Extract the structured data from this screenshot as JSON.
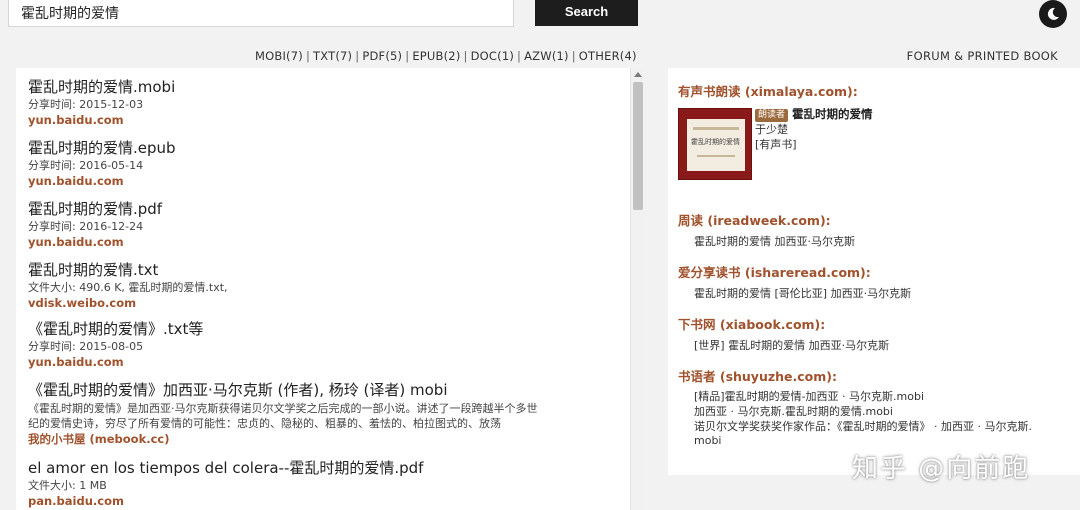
{
  "search": {
    "query": "霍乱时期的爱情",
    "button_label": "Search"
  },
  "filters": [
    {
      "label": "MOBI(7)"
    },
    {
      "label": "TXT(7)"
    },
    {
      "label": "PDF(5)"
    },
    {
      "label": "EPUB(2)"
    },
    {
      "label": "DOC(1)"
    },
    {
      "label": "AZW(1)"
    },
    {
      "label": "OTHER(4)"
    }
  ],
  "forum_link": "FORUM & PRINTED BOOK",
  "results": [
    {
      "title": "霍乱时期的爱情.mobi",
      "meta": "分享时间: 2015-12-03",
      "source": "yun.baidu.com"
    },
    {
      "title": "霍乱时期的爱情.epub",
      "meta": "分享时间: 2016-05-14",
      "source": "yun.baidu.com"
    },
    {
      "title": "霍乱时期的爱情.pdf",
      "meta": "分享时间: 2016-12-24",
      "source": "yun.baidu.com"
    },
    {
      "title": "霍乱时期的爱情.txt",
      "meta": "文件大小: 490.6 K, 霍乱时期的爱情.txt,",
      "source": "vdisk.weibo.com"
    },
    {
      "title": "《霍乱时期的爱情》.txt等",
      "meta": "分享时间: 2015-08-05",
      "source": "yun.baidu.com"
    },
    {
      "title": "《霍乱时期的爱情》加西亚·马尔克斯 (作者), 杨玲 (译者) mobi",
      "desc": "《霍乱时期的爱情》是加西亚·马尔克斯获得诺贝尔文学奖之后完成的一部小说。讲述了一段跨越半个多世纪的爱情史诗，穷尽了所有爱情的可能性：忠贞的、隐秘的、粗暴的、羞怯的、柏拉图式的、放荡",
      "source": "我的小书屋 (mebook.cc)"
    },
    {
      "title": "el amor en los tiempos del colera--霍乱时期的爱情.pdf",
      "meta": "文件大小: 1 MB",
      "source": "pan.baidu.com"
    }
  ],
  "sidebar": {
    "ximalaya": {
      "heading": "有声书朗读 (ximalaya.com):",
      "badge": "朗读者",
      "book_title": "霍乱时期的爱情",
      "narrator": "于少楚",
      "tag": "[有声书]",
      "cover_text": "霍乱时期的爱情"
    },
    "ireadweek": {
      "heading": "周读 (ireadweek.com):",
      "lines": [
        "霍乱时期的爱情 加西亚·马尔克斯"
      ]
    },
    "ishareread": {
      "heading": "爱分享读书 (ishareread.com):",
      "lines": [
        "霍乱时期的爱情 [哥伦比亚] 加西亚·马尔克斯"
      ]
    },
    "xiabook": {
      "heading": "下书网 (xiabook.com):",
      "lines": [
        "[世界] 霍乱时期的爱情 加西亚·马尔克斯"
      ]
    },
    "shuyuzhe": {
      "heading": "书语者 (shuyuzhe.com):",
      "lines": [
        "[精品]霍乱时期的爱情-加西亚 · 马尔克斯.mobi",
        "加西亚 · 马尔克斯.霍乱时期的爱情.mobi",
        "诺贝尔文学奖获奖作家作品：《霍乱时期的爱情》 · 加西亚 · 马尔克斯.",
        "mobi"
      ]
    }
  },
  "watermark": "知乎 @向前跑",
  "colors": {
    "accent": "#a0522d",
    "button": "#1d1d1d"
  }
}
